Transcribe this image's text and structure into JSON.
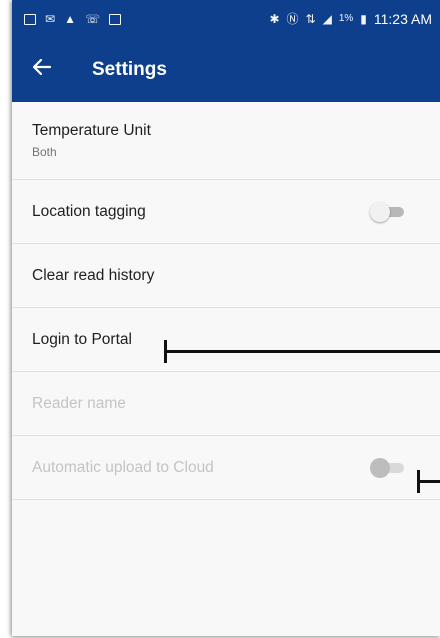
{
  "status_bar": {
    "left_icons": [
      "image-icon",
      "mail-icon",
      "warning-icon",
      "wifi-call-icon",
      "gallery-icon"
    ],
    "right_icons": [
      "bluetooth-icon",
      "nfc-icon",
      "data-icon",
      "signal-icon"
    ],
    "battery": "1%",
    "time": "11:23 AM"
  },
  "app_bar": {
    "back_icon": "arrow-left-icon",
    "title": "Settings"
  },
  "settings": {
    "temperature_unit": {
      "title": "Temperature Unit",
      "value": "Both"
    },
    "location_tagging": {
      "title": "Location tagging",
      "enabled": false
    },
    "clear_read_history": {
      "title": "Clear read history"
    },
    "login_to_portal": {
      "title": "Login to Portal"
    },
    "reader_name": {
      "title": "Reader name",
      "disabled": true
    },
    "automatic_upload": {
      "title": "Automatic upload to Cloud",
      "enabled": false,
      "disabled": true
    }
  },
  "colors": {
    "app_bar": "#0e3f8c",
    "background": "#f8f8f8",
    "divider": "#e1e1e1",
    "disabled_text": "#c4c4c4",
    "callout": "#111111"
  }
}
